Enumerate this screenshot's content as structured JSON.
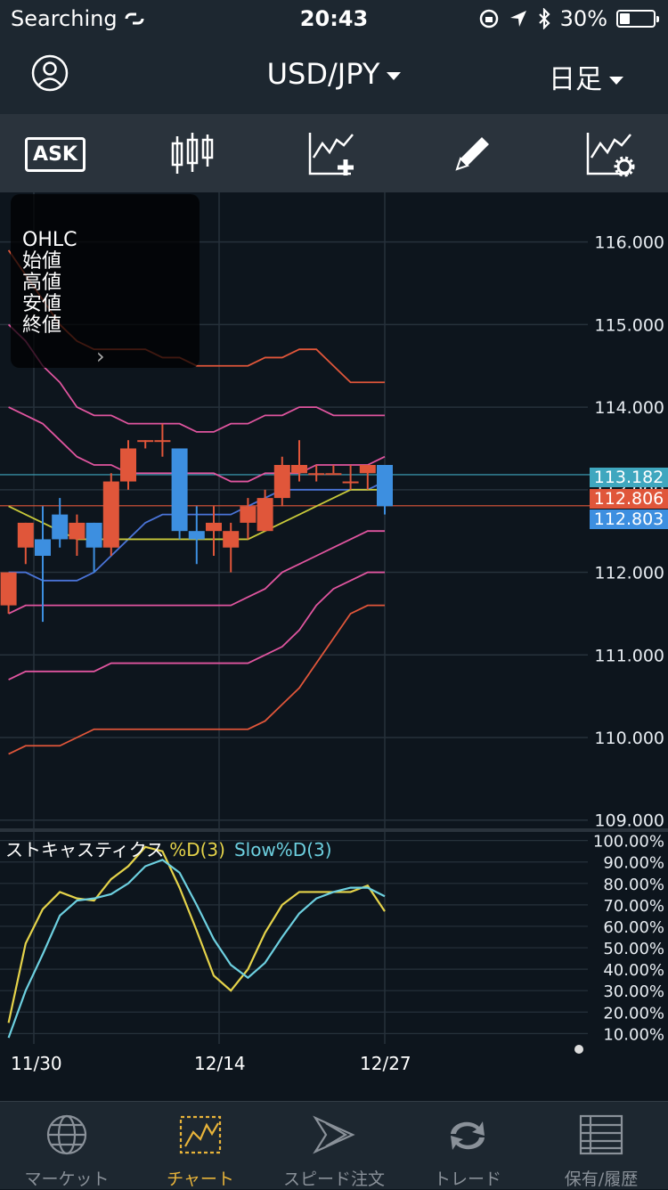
{
  "status_bar": {
    "carrier": "Searching",
    "time": "20:43",
    "battery": "30%",
    "battery_level": 0.3
  },
  "header": {
    "pair": "USD/JPY",
    "period": "日足"
  },
  "toolbar": {
    "ask_label": "ASK"
  },
  "ohlc_panel": {
    "labels": [
      "OHLC",
      "始値",
      "高値",
      "安値",
      "終値"
    ]
  },
  "price_axis": {
    "ticks": [
      "116.000",
      "115.000",
      "114.000",
      "113.000",
      "112.000",
      "111.000",
      "110.000",
      "109.000"
    ]
  },
  "price_tags": [
    {
      "value": "113.182",
      "color": "#3fa7bf"
    },
    {
      "value": "112.806",
      "color": "#e0563a"
    },
    {
      "value": "112.803",
      "color": "#3d8fe0"
    }
  ],
  "oscillator": {
    "name": "ストキャスティクス",
    "d_label": "%D(3)",
    "slowd_label": "Slow%D(3)",
    "ticks": [
      "100.00%",
      "90.00%",
      "80.00%",
      "70.00%",
      "60.00%",
      "50.00%",
      "40.00%",
      "30.00%",
      "20.00%",
      "10.00%"
    ]
  },
  "dates": [
    "11/30",
    "12/14",
    "12/27"
  ],
  "tabs": [
    {
      "label": "マーケット",
      "active": false,
      "icon": "globe-icon"
    },
    {
      "label": "チャート",
      "active": true,
      "icon": "chart-icon"
    },
    {
      "label": "スピード注文",
      "active": false,
      "icon": "speed-order-icon"
    },
    {
      "label": "トレード",
      "active": false,
      "icon": "trade-icon"
    },
    {
      "label": "保有/履歴",
      "active": false,
      "icon": "history-icon"
    }
  ],
  "colors": {
    "up": "#e0563a",
    "down": "#3d8fe0",
    "accent": "#e8b43a",
    "d_line": "#e5d34a",
    "slowd_line": "#6dd0e0"
  },
  "chart_data": [
    {
      "type": "candlestick",
      "title": "USD/JPY 日足",
      "ylim": [
        109.0,
        116.2
      ],
      "x_labels": [
        "11/30",
        "12/14",
        "12/27"
      ],
      "candles": [
        {
          "o": 111.6,
          "h": 112.0,
          "l": 111.5,
          "c": 112.0
        },
        {
          "o": 112.3,
          "h": 112.6,
          "l": 112.1,
          "c": 112.6
        },
        {
          "o": 112.4,
          "h": 112.8,
          "l": 111.4,
          "c": 112.2
        },
        {
          "o": 112.7,
          "h": 112.9,
          "l": 112.3,
          "c": 112.4
        },
        {
          "o": 112.4,
          "h": 112.7,
          "l": 112.2,
          "c": 112.6
        },
        {
          "o": 112.6,
          "h": 112.6,
          "l": 112.0,
          "c": 112.3
        },
        {
          "o": 112.3,
          "h": 113.2,
          "l": 112.2,
          "c": 113.1
        },
        {
          "o": 113.1,
          "h": 113.6,
          "l": 113.0,
          "c": 113.5
        },
        {
          "o": 113.6,
          "h": 113.6,
          "l": 113.5,
          "c": 113.6
        },
        {
          "o": 113.6,
          "h": 113.8,
          "l": 113.4,
          "c": 113.6
        },
        {
          "o": 113.5,
          "h": 113.5,
          "l": 112.4,
          "c": 112.5
        },
        {
          "o": 112.5,
          "h": 112.8,
          "l": 112.1,
          "c": 112.4
        },
        {
          "o": 112.5,
          "h": 112.8,
          "l": 112.2,
          "c": 112.6
        },
        {
          "o": 112.3,
          "h": 112.6,
          "l": 112.0,
          "c": 112.5
        },
        {
          "o": 112.6,
          "h": 112.9,
          "l": 112.4,
          "c": 112.8
        },
        {
          "o": 112.5,
          "h": 113.0,
          "l": 112.5,
          "c": 112.9
        },
        {
          "o": 112.9,
          "h": 113.4,
          "l": 112.8,
          "c": 113.3
        },
        {
          "o": 113.2,
          "h": 113.6,
          "l": 113.1,
          "c": 113.3
        },
        {
          "o": 113.2,
          "h": 113.3,
          "l": 113.1,
          "c": 113.2
        },
        {
          "o": 113.2,
          "h": 113.3,
          "l": 113.2,
          "c": 113.2
        },
        {
          "o": 113.1,
          "h": 113.3,
          "l": 113.0,
          "c": 113.1
        },
        {
          "o": 113.2,
          "h": 113.3,
          "l": 113.0,
          "c": 113.3
        },
        {
          "o": 113.3,
          "h": 113.3,
          "l": 112.7,
          "c": 112.8
        }
      ],
      "bands": [
        {
          "name": "upper3",
          "color": "#e0563a",
          "values": [
            115.9,
            115.6,
            115.3,
            115.0,
            114.8,
            114.7,
            114.7,
            114.7,
            114.7,
            114.6,
            114.6,
            114.5,
            114.5,
            114.5,
            114.5,
            114.6,
            114.6,
            114.7,
            114.7,
            114.5,
            114.3,
            114.3,
            114.3
          ]
        },
        {
          "name": "upper2",
          "color": "#e0559f",
          "values": [
            115.0,
            114.8,
            114.5,
            114.3,
            114.0,
            113.9,
            113.9,
            113.8,
            113.8,
            113.8,
            113.8,
            113.7,
            113.7,
            113.8,
            113.8,
            113.9,
            113.9,
            114.0,
            114.0,
            113.9,
            113.9,
            113.9,
            113.9
          ]
        },
        {
          "name": "upper1",
          "color": "#e0559f",
          "values": [
            114.0,
            113.9,
            113.8,
            113.6,
            113.4,
            113.3,
            113.3,
            113.2,
            113.2,
            113.2,
            113.2,
            113.2,
            113.2,
            113.1,
            113.1,
            113.2,
            113.2,
            113.2,
            113.3,
            113.3,
            113.3,
            113.3,
            113.4
          ]
        },
        {
          "name": "ma",
          "color": "#4a74d8",
          "values": [
            112.0,
            112.0,
            111.9,
            111.9,
            111.9,
            112.0,
            112.2,
            112.4,
            112.6,
            112.7,
            112.7,
            112.7,
            112.7,
            112.7,
            112.8,
            112.9,
            113.0,
            113.0,
            113.0,
            113.0,
            113.0,
            113.0,
            113.1
          ]
        },
        {
          "name": "ma2",
          "color": "#c8c93a",
          "values": [
            112.8,
            112.7,
            112.6,
            112.5,
            112.4,
            112.4,
            112.4,
            112.4,
            112.4,
            112.4,
            112.4,
            112.4,
            112.4,
            112.4,
            112.4,
            112.5,
            112.6,
            112.7,
            112.8,
            112.9,
            113.0,
            113.0,
            113.0
          ]
        },
        {
          "name": "lower1",
          "color": "#e0559f",
          "values": [
            111.5,
            111.6,
            111.6,
            111.6,
            111.6,
            111.6,
            111.6,
            111.6,
            111.6,
            111.6,
            111.6,
            111.6,
            111.6,
            111.6,
            111.7,
            111.8,
            112.0,
            112.1,
            112.2,
            112.3,
            112.4,
            112.5,
            112.5
          ]
        },
        {
          "name": "lower2",
          "color": "#e0559f",
          "values": [
            110.7,
            110.8,
            110.8,
            110.8,
            110.8,
            110.8,
            110.9,
            110.9,
            110.9,
            110.9,
            110.9,
            110.9,
            110.9,
            110.9,
            110.9,
            111.0,
            111.1,
            111.3,
            111.6,
            111.8,
            111.9,
            112.0,
            112.0
          ]
        },
        {
          "name": "lower3",
          "color": "#e0563a",
          "values": [
            109.8,
            109.9,
            109.9,
            109.9,
            110.0,
            110.1,
            110.1,
            110.1,
            110.1,
            110.1,
            110.1,
            110.1,
            110.1,
            110.1,
            110.1,
            110.2,
            110.4,
            110.6,
            110.9,
            111.2,
            111.5,
            111.6,
            111.6
          ]
        }
      ]
    },
    {
      "type": "line",
      "title": "ストキャスティクス",
      "ylim": [
        8,
        100
      ],
      "series": [
        {
          "name": "%D(3)",
          "color": "#e5d34a",
          "values": [
            15,
            52,
            68,
            76,
            73,
            72,
            82,
            88,
            97,
            95,
            78,
            58,
            37,
            30,
            40,
            57,
            70,
            76,
            76,
            76,
            76,
            79,
            67
          ]
        },
        {
          "name": "Slow%D(3)",
          "color": "#6dd0e0",
          "values": [
            8,
            30,
            47,
            65,
            72,
            73,
            75,
            80,
            88,
            91,
            85,
            70,
            54,
            42,
            36,
            43,
            55,
            66,
            73,
            76,
            78,
            78,
            74
          ]
        }
      ]
    }
  ]
}
